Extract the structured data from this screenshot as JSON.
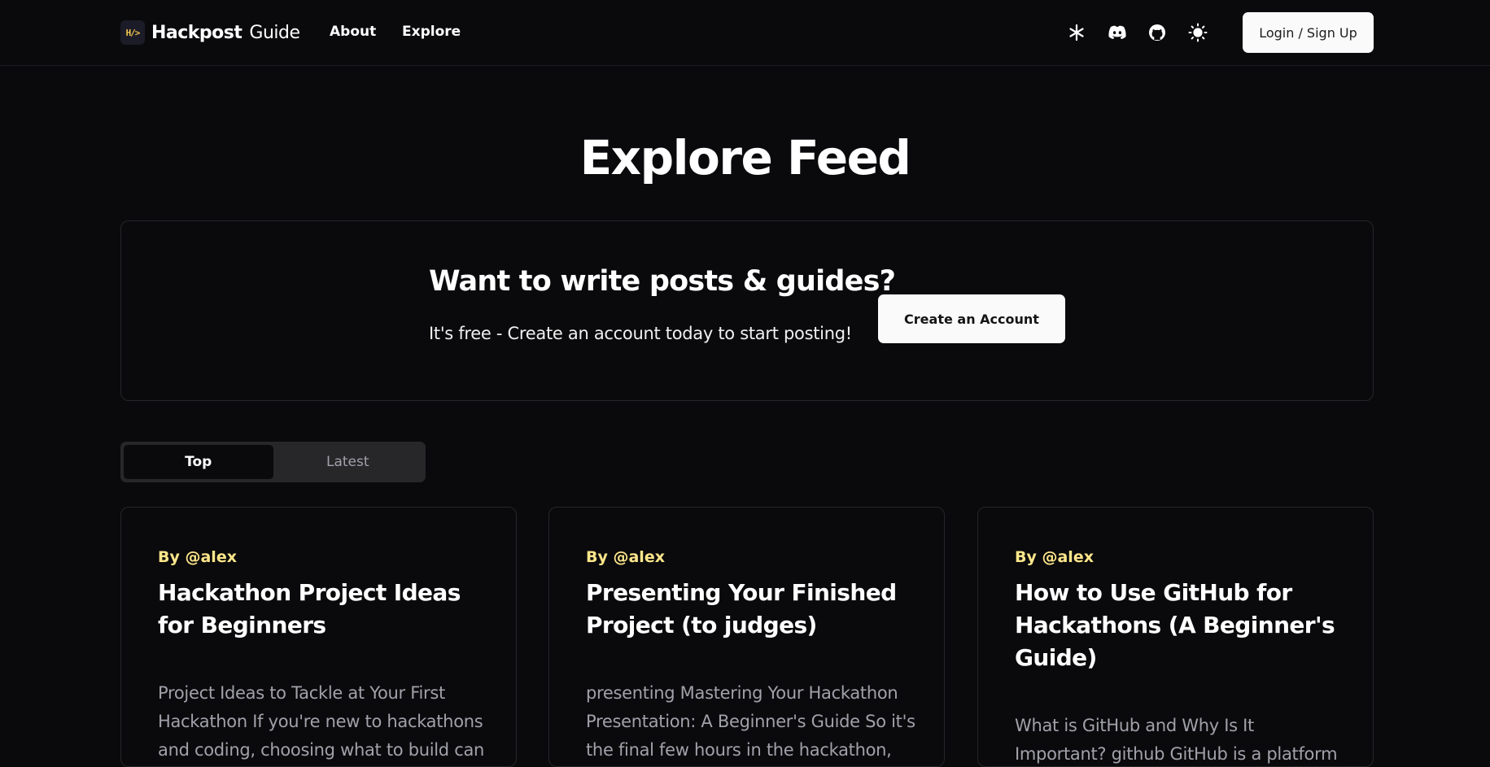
{
  "nav": {
    "logo_mark": "H/>",
    "brand": "Hackpost",
    "brand_sub": "Guide",
    "links": [
      "About",
      "Explore"
    ],
    "icons": [
      "asterisk-icon",
      "discord-icon",
      "github-icon",
      "sun-icon"
    ],
    "login_label": "Login / Sign Up"
  },
  "page": {
    "title": "Explore Feed"
  },
  "cta": {
    "heading": "Want to write posts & guides?",
    "text": "It's free - Create an account today to start posting!",
    "button_label": "Create an Account"
  },
  "tabs": [
    {
      "label": "Top",
      "active": true
    },
    {
      "label": "Latest",
      "active": false
    }
  ],
  "posts": [
    {
      "author": "By @alex",
      "title": "Hackathon Project Ideas for Beginners",
      "excerpt": "Project Ideas to Tackle at Your First Hackathon If you're new to hackathons and coding, choosing what to build can"
    },
    {
      "author": "By @alex",
      "title": "Presenting Your Finished Project (to judges)",
      "excerpt": "presenting Mastering Your Hackathon Presentation: A Beginner's Guide So it's the final few hours in the hackathon,"
    },
    {
      "author": "By @alex",
      "title": "How to Use GitHub for Hackathons (A Beginner's Guide)",
      "excerpt": "What is GitHub and Why Is It Important? github GitHub is a platform"
    }
  ],
  "colors": {
    "background": "#0a0a0c",
    "author_accent": "#fde68a",
    "logo_accent": "#f3c84b"
  }
}
